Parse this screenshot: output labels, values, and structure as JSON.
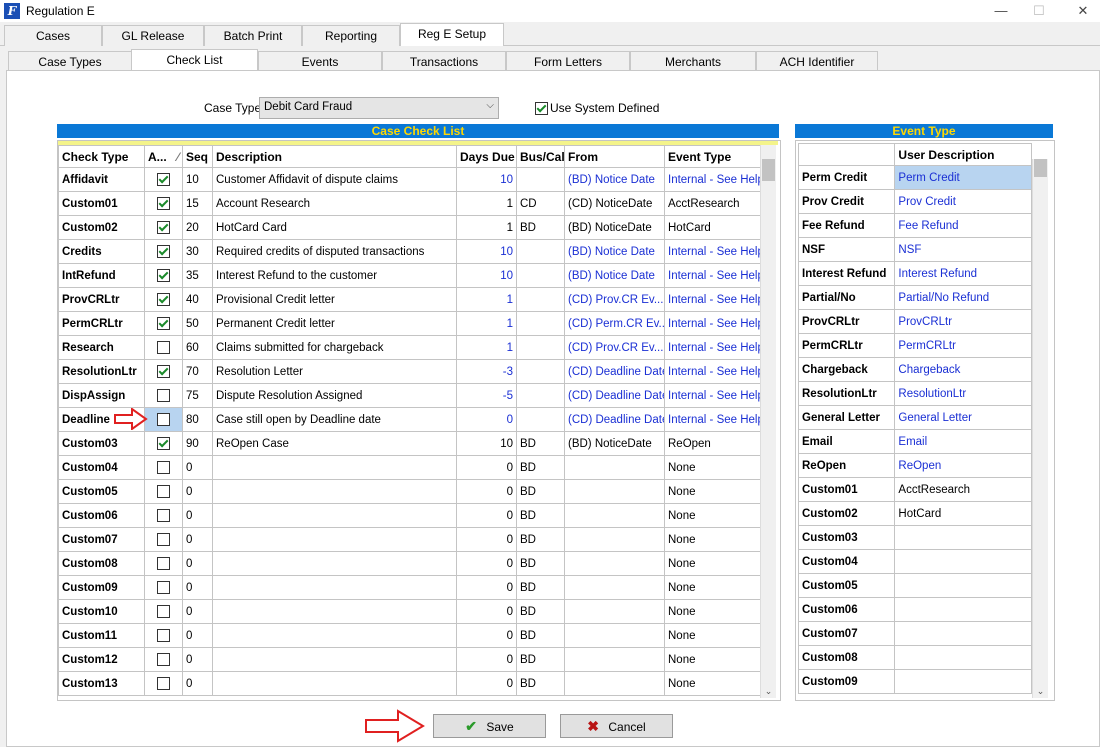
{
  "window": {
    "title": "Regulation E",
    "minimize": "—",
    "maximize": "☐",
    "close": "✕"
  },
  "main_tabs": [
    "Cases",
    "GL Release",
    "Batch Print",
    "Reporting",
    "Reg E Setup"
  ],
  "sub_tabs": [
    "Case Types",
    "Check List",
    "Events",
    "Transactions",
    "Form Letters",
    "Merchants",
    "ACH Identifier"
  ],
  "case_type": {
    "label": "Case Type",
    "value": "Debit Card Fraud"
  },
  "use_system_defined": {
    "label": "Use System Defined",
    "checked": true
  },
  "case_check_list": {
    "header": "Case Check List",
    "columns": [
      "Check Type",
      "A...",
      "Seq",
      "Description",
      "Days Due",
      "Bus/Cal",
      "From",
      "Event Type"
    ],
    "rows": [
      {
        "type": "Affidavit",
        "active": true,
        "seq": "10",
        "desc": "Customer Affidavit of dispute claims",
        "days": "10",
        "buscal": "",
        "from": "(BD) Notice Date",
        "event": "Internal - See Help",
        "blue": true
      },
      {
        "type": "Custom01",
        "active": true,
        "seq": "15",
        "desc": "Account Research",
        "days": "1",
        "buscal": "CD",
        "from": "(CD) NoticeDate",
        "event": "AcctResearch",
        "blue": false
      },
      {
        "type": "Custom02",
        "active": true,
        "seq": "20",
        "desc": "HotCard Card",
        "days": "1",
        "buscal": "BD",
        "from": "(BD) NoticeDate",
        "event": "HotCard",
        "blue": false
      },
      {
        "type": "Credits",
        "active": true,
        "seq": "30",
        "desc": "Required credits of disputed transactions",
        "days": "10",
        "buscal": "",
        "from": "(BD) Notice Date",
        "event": "Internal - See Help",
        "blue": true
      },
      {
        "type": "IntRefund",
        "active": true,
        "seq": "35",
        "desc": "Interest Refund to the customer",
        "days": "10",
        "buscal": "",
        "from": "(BD) Notice Date",
        "event": "Internal - See Help",
        "blue": true
      },
      {
        "type": "ProvCRLtr",
        "active": true,
        "seq": "40",
        "desc": "Provisional Credit letter",
        "days": "1",
        "buscal": "",
        "from": "(CD) Prov.CR Ev...",
        "event": "Internal - See Help",
        "blue": true
      },
      {
        "type": "PermCRLtr",
        "active": true,
        "seq": "50",
        "desc": "Permanent Credit letter",
        "days": "1",
        "buscal": "",
        "from": "(CD) Perm.CR Ev...",
        "event": "Internal - See Help",
        "blue": true
      },
      {
        "type": "Research",
        "active": false,
        "seq": "60",
        "desc": "Claims submitted for chargeback",
        "days": "1",
        "buscal": "",
        "from": "(CD) Prov.CR Ev...",
        "event": "Internal - See Help",
        "blue": true
      },
      {
        "type": "ResolutionLtr",
        "active": true,
        "seq": "70",
        "desc": "Resolution Letter",
        "days": "-3",
        "buscal": "",
        "from": "(CD) Deadline Date",
        "event": "Internal - See Help",
        "blue": true
      },
      {
        "type": "DispAssign",
        "active": false,
        "seq": "75",
        "desc": "Dispute Resolution Assigned",
        "days": "-5",
        "buscal": "",
        "from": "(CD) Deadline Date",
        "event": "Internal - See Help",
        "blue": true
      },
      {
        "type": "Deadline",
        "active": false,
        "seq": "80",
        "desc": "Case still open by Deadline date",
        "days": "0",
        "buscal": "",
        "from": "(CD) Deadline Date",
        "event": "Internal - See Help",
        "blue": true
      },
      {
        "type": "Custom03",
        "active": true,
        "seq": "90",
        "desc": "ReOpen Case",
        "days": "10",
        "buscal": "BD",
        "from": "(BD) NoticeDate",
        "event": "ReOpen",
        "blue": false
      },
      {
        "type": "Custom04",
        "active": false,
        "seq": "0",
        "desc": "",
        "days": "0",
        "buscal": "BD",
        "from": "",
        "event": "None",
        "blue": false
      },
      {
        "type": "Custom05",
        "active": false,
        "seq": "0",
        "desc": "",
        "days": "0",
        "buscal": "BD",
        "from": "",
        "event": "None",
        "blue": false
      },
      {
        "type": "Custom06",
        "active": false,
        "seq": "0",
        "desc": "",
        "days": "0",
        "buscal": "BD",
        "from": "",
        "event": "None",
        "blue": false
      },
      {
        "type": "Custom07",
        "active": false,
        "seq": "0",
        "desc": "",
        "days": "0",
        "buscal": "BD",
        "from": "",
        "event": "None",
        "blue": false
      },
      {
        "type": "Custom08",
        "active": false,
        "seq": "0",
        "desc": "",
        "days": "0",
        "buscal": "BD",
        "from": "",
        "event": "None",
        "blue": false
      },
      {
        "type": "Custom09",
        "active": false,
        "seq": "0",
        "desc": "",
        "days": "0",
        "buscal": "BD",
        "from": "",
        "event": "None",
        "blue": false
      },
      {
        "type": "Custom10",
        "active": false,
        "seq": "0",
        "desc": "",
        "days": "0",
        "buscal": "BD",
        "from": "",
        "event": "None",
        "blue": false
      },
      {
        "type": "Custom11",
        "active": false,
        "seq": "0",
        "desc": "",
        "days": "0",
        "buscal": "BD",
        "from": "",
        "event": "None",
        "blue": false
      },
      {
        "type": "Custom12",
        "active": false,
        "seq": "0",
        "desc": "",
        "days": "0",
        "buscal": "BD",
        "from": "",
        "event": "None",
        "blue": false
      },
      {
        "type": "Custom13",
        "active": false,
        "seq": "0",
        "desc": "",
        "days": "0",
        "buscal": "BD",
        "from": "",
        "event": "None",
        "blue": false
      }
    ]
  },
  "event_type": {
    "header": "Event Type",
    "columns": [
      "",
      "User Description"
    ],
    "rows": [
      {
        "name": "Perm Credit",
        "desc": "Perm Credit",
        "blue": true,
        "selected": true
      },
      {
        "name": "Prov Credit",
        "desc": "Prov Credit",
        "blue": true
      },
      {
        "name": "Fee Refund",
        "desc": "Fee Refund",
        "blue": true
      },
      {
        "name": "NSF",
        "desc": "NSF",
        "blue": true
      },
      {
        "name": "Interest Refund",
        "desc": "Interest Refund",
        "blue": true
      },
      {
        "name": "Partial/No",
        "desc": "Partial/No Refund",
        "blue": true
      },
      {
        "name": "ProvCRLtr",
        "desc": "ProvCRLtr",
        "blue": true
      },
      {
        "name": "PermCRLtr",
        "desc": "PermCRLtr",
        "blue": true
      },
      {
        "name": "Chargeback",
        "desc": "Chargeback",
        "blue": true
      },
      {
        "name": "ResolutionLtr",
        "desc": "ResolutionLtr",
        "blue": true
      },
      {
        "name": "General Letter",
        "desc": "General Letter",
        "blue": true
      },
      {
        "name": "Email",
        "desc": "Email",
        "blue": true
      },
      {
        "name": "ReOpen",
        "desc": "ReOpen",
        "blue": true
      },
      {
        "name": "Custom01",
        "desc": "AcctResearch",
        "blue": false
      },
      {
        "name": "Custom02",
        "desc": "HotCard",
        "blue": false
      },
      {
        "name": "Custom03",
        "desc": "",
        "blue": false
      },
      {
        "name": "Custom04",
        "desc": "",
        "blue": false
      },
      {
        "name": "Custom05",
        "desc": "",
        "blue": false
      },
      {
        "name": "Custom06",
        "desc": "",
        "blue": false
      },
      {
        "name": "Custom07",
        "desc": "",
        "blue": false
      },
      {
        "name": "Custom08",
        "desc": "",
        "blue": false
      },
      {
        "name": "Custom09",
        "desc": "",
        "blue": false
      }
    ]
  },
  "buttons": {
    "save": "Save",
    "cancel": "Cancel"
  },
  "colors": {
    "grid_header_bg": "#0a78d6",
    "grid_header_text": "#ffd800",
    "link_blue": "#1a2fd4",
    "annotation_arrow": "#e02020",
    "selected_cell": "#b8d4f0"
  }
}
